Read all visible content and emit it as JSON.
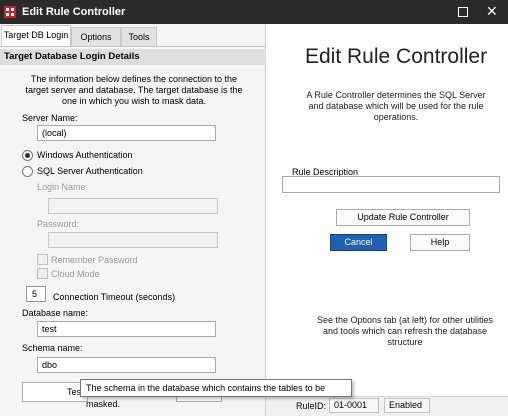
{
  "window": {
    "title": "Edit Rule Controller"
  },
  "tabs": [
    {
      "label": "Target DB Login"
    },
    {
      "label": "Options"
    },
    {
      "label": "Tools"
    }
  ],
  "left": {
    "section_title": "Target Database Login Details",
    "info": "The information below defines the connection to the target server and database. The target database is the one in which you wish to mask data.",
    "server_label": "Server Name:",
    "server_value": "(local)",
    "windows_auth": "Windows Authentication",
    "sql_auth": "SQL Server Authentication",
    "auth_selected": "windows",
    "login_label": "Login Name:",
    "login_value": "",
    "password_label": "Password:",
    "password_value": "",
    "remember_password": "Remember Password",
    "cloud_mode": "Cloud Mode",
    "timeout_value": "5",
    "timeout_label": "Connection Timeout (seconds)",
    "db_label": "Database name:",
    "db_value": "test",
    "schema_label": "Schema name:",
    "schema_value": "dbo",
    "test_button": "Tes"
  },
  "right": {
    "title": "Edit Rule Controller",
    "info": "A Rule Controller determines the SQL Server and database which will be used for the rule operations.",
    "rule_desc_label": "Rule Description",
    "rule_desc_value": "",
    "update_button": "Update Rule Controller",
    "cancel_button": "Cancel",
    "help_button": "Help",
    "options_info": "See the Options tab (at left) for other utilities and tools which can refresh the database structure"
  },
  "status": {
    "ruleid_label": "RuleID:",
    "ruleid_value": "01-0001",
    "state": "Enabled"
  },
  "tooltip": "The schema in the database which contains the tables to be masked.",
  "colors": {
    "titlebar": "#2b2b2b",
    "brand": "#c9252b",
    "primary_button": "#1f60b3"
  }
}
